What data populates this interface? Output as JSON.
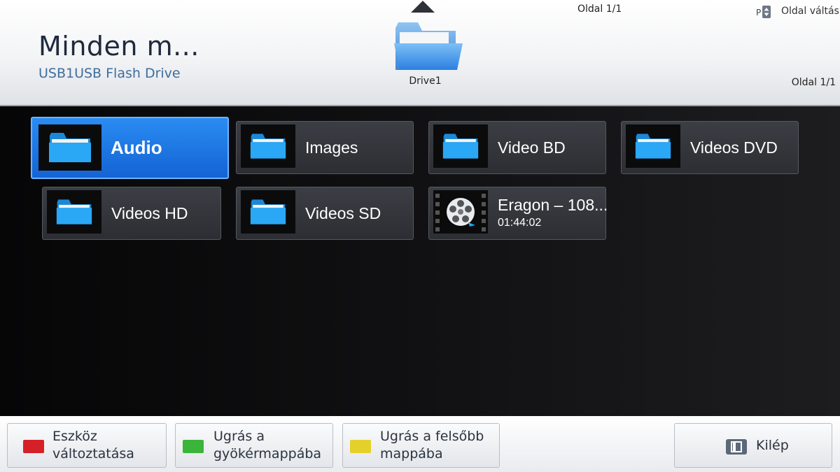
{
  "header": {
    "title": "Minden m...",
    "subtitle": "USB1USB Flash Drive",
    "drive_label": "Drive1",
    "page_top": "Oldal 1/1",
    "page_right": "Oldal 1/1",
    "page_switch_key": "P",
    "page_switch_label": "Oldal váltás"
  },
  "tiles": [
    {
      "label": "Audio",
      "type": "folder",
      "selected": true
    },
    {
      "label": "Images",
      "type": "folder"
    },
    {
      "label": "Video BD",
      "type": "folder"
    },
    {
      "label": "Videos DVD",
      "type": "folder"
    },
    {
      "label": "Videos HD",
      "type": "folder"
    },
    {
      "label": "Videos SD",
      "type": "folder"
    },
    {
      "label": "Eragon – 108...",
      "duration": "01:44:02",
      "type": "video"
    }
  ],
  "footer": {
    "red_label": "Eszköz változtatása",
    "green_label_1": "Ugrás a",
    "green_label_2": "gyökérmappába",
    "yellow_label_1": "Ugrás a felsőbb",
    "yellow_label_2": "mappába",
    "exit_label": "Kilép"
  },
  "colors": {
    "selected_tile": "#1a73e8",
    "folder_blue": "#1fa8f0",
    "red_key": "#d62028",
    "green_key": "#3ab53a",
    "yellow_key": "#e3d12a"
  }
}
